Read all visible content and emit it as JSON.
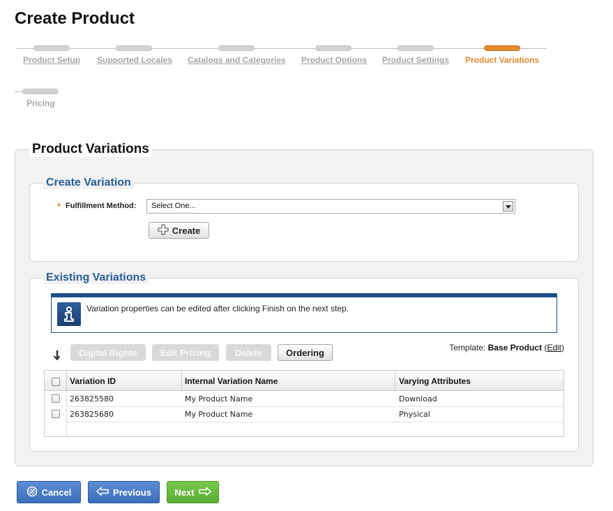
{
  "page": {
    "title": "Create Product"
  },
  "wizard": {
    "steps": [
      {
        "label": "Product Setup",
        "state": "done"
      },
      {
        "label": "Supported Locales",
        "state": "done"
      },
      {
        "label": "Catalogs and Categories",
        "state": "done"
      },
      {
        "label": "Product Options",
        "state": "done"
      },
      {
        "label": "Product Settings",
        "state": "done"
      },
      {
        "label": "Product Variations",
        "state": "active"
      },
      {
        "label": "Pricing",
        "state": "pending"
      }
    ]
  },
  "product_variations": {
    "title": "Product Variations",
    "create_variation": {
      "title": "Create Variation",
      "required_marker": "*",
      "fulfillment_label": "Fulfillment Method:",
      "fulfillment_value": "Select One...",
      "create_button": "Create"
    },
    "existing_variations": {
      "title": "Existing Variations",
      "info_message": "Variation properties can be edited after clicking Finish on the next step.",
      "toolbar": {
        "digital_rights": "Digital Rights",
        "edit_pricing": "Edit Pricing",
        "delete": "Delete",
        "ordering": "Ordering"
      },
      "template": {
        "label": "Template:",
        "value": "Base Product",
        "edit_link": "Edit",
        "paren_open": "(",
        "paren_close": ")"
      },
      "columns": [
        "Variation ID",
        "Internal Variation Name",
        "Varying Attributes"
      ],
      "rows": [
        {
          "id": "263825580",
          "name": "My Product Name",
          "attributes": "Download"
        },
        {
          "id": "263825680",
          "name": "My Product Name",
          "attributes": "Physical"
        }
      ]
    }
  },
  "footer": {
    "cancel": "Cancel",
    "previous": "Previous",
    "next": "Next"
  },
  "colors": {
    "accent_orange": "#e58a2e",
    "section_blue": "#275e97",
    "info_blue": "#1d4f8a",
    "button_blue": "#3b6dbb",
    "button_green": "#5aad32"
  },
  "icons": [
    "plus-icon",
    "info-icon",
    "sort-arrow-icon",
    "cancel-icon",
    "arrow-left-icon",
    "arrow-right-icon",
    "dropdown-arrow-icon"
  ]
}
